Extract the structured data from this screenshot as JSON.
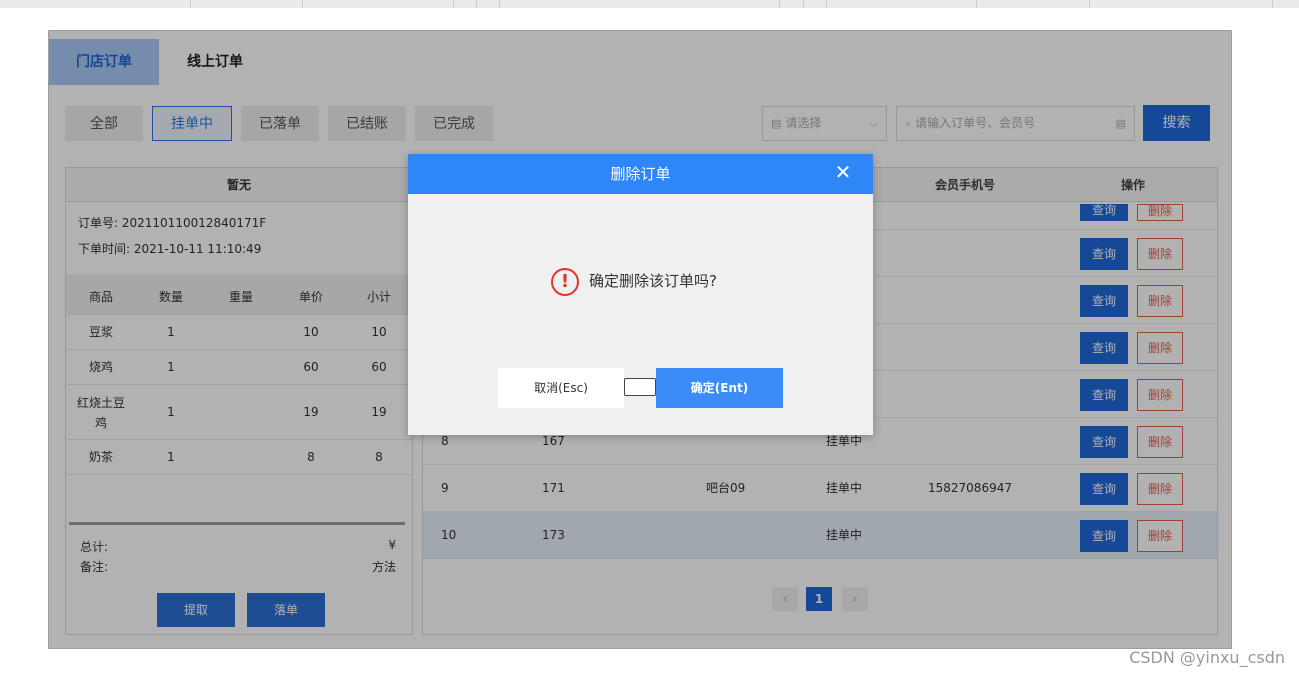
{
  "tabs": [
    "门店订单",
    "线上订单"
  ],
  "filters": [
    "全部",
    "挂单中",
    "已落单",
    "已结账",
    "已完成"
  ],
  "selected_filter": "挂单中",
  "select_placeholder": "请选择",
  "search_placeholder": "请输入订单号、会员号",
  "search_button": "搜索",
  "order_panel": {
    "title": "暂无",
    "order_no_label": "订单号:",
    "order_no": "202110110012840171F",
    "time_label": "下单时间:",
    "time": "2021-10-11 11:10:49",
    "columns": [
      "商品",
      "数量",
      "重量",
      "单价",
      "小计"
    ],
    "items": [
      {
        "name": "豆浆",
        "qty": "1",
        "weight": "",
        "price": "10",
        "subtotal": "10"
      },
      {
        "name": "烧鸡",
        "qty": "1",
        "weight": "",
        "price": "60",
        "subtotal": "60"
      },
      {
        "name": "红烧土豆鸡",
        "qty": "1",
        "weight": "",
        "price": "19",
        "subtotal": "19"
      },
      {
        "name": "奶茶",
        "qty": "1",
        "weight": "",
        "price": "8",
        "subtotal": "8"
      }
    ],
    "total_label": "总计:",
    "total_value": "¥",
    "note_label": "备注:",
    "note_value": "方法",
    "fetch_button": "提取",
    "place_button": "落单"
  },
  "orders_table": {
    "columns": [
      "会员手机号",
      "操作"
    ],
    "query_label": "查询",
    "delete_label": "删除",
    "rows": [
      {
        "no": "8",
        "id": "167",
        "table": "",
        "status": "挂单中",
        "phone": ""
      },
      {
        "no": "9",
        "id": "171",
        "table": "吧台09",
        "status": "挂单中",
        "phone": "15827086947"
      },
      {
        "no": "10",
        "id": "173",
        "table": "",
        "status": "挂单中",
        "phone": ""
      }
    ]
  },
  "pagination": {
    "prev": "‹",
    "current": "1",
    "next": "›"
  },
  "modal": {
    "title": "删除订单",
    "message": "确定删除该订单吗?",
    "cancel": "取消(Esc)",
    "ok": "确定(Ent)"
  },
  "watermark": "CSDN @yinxu_csdn",
  "colors": {
    "primary": "#1f68d9",
    "modal_header": "#2e86f7",
    "danger": "#e0604d",
    "warning": "#e5332a"
  }
}
